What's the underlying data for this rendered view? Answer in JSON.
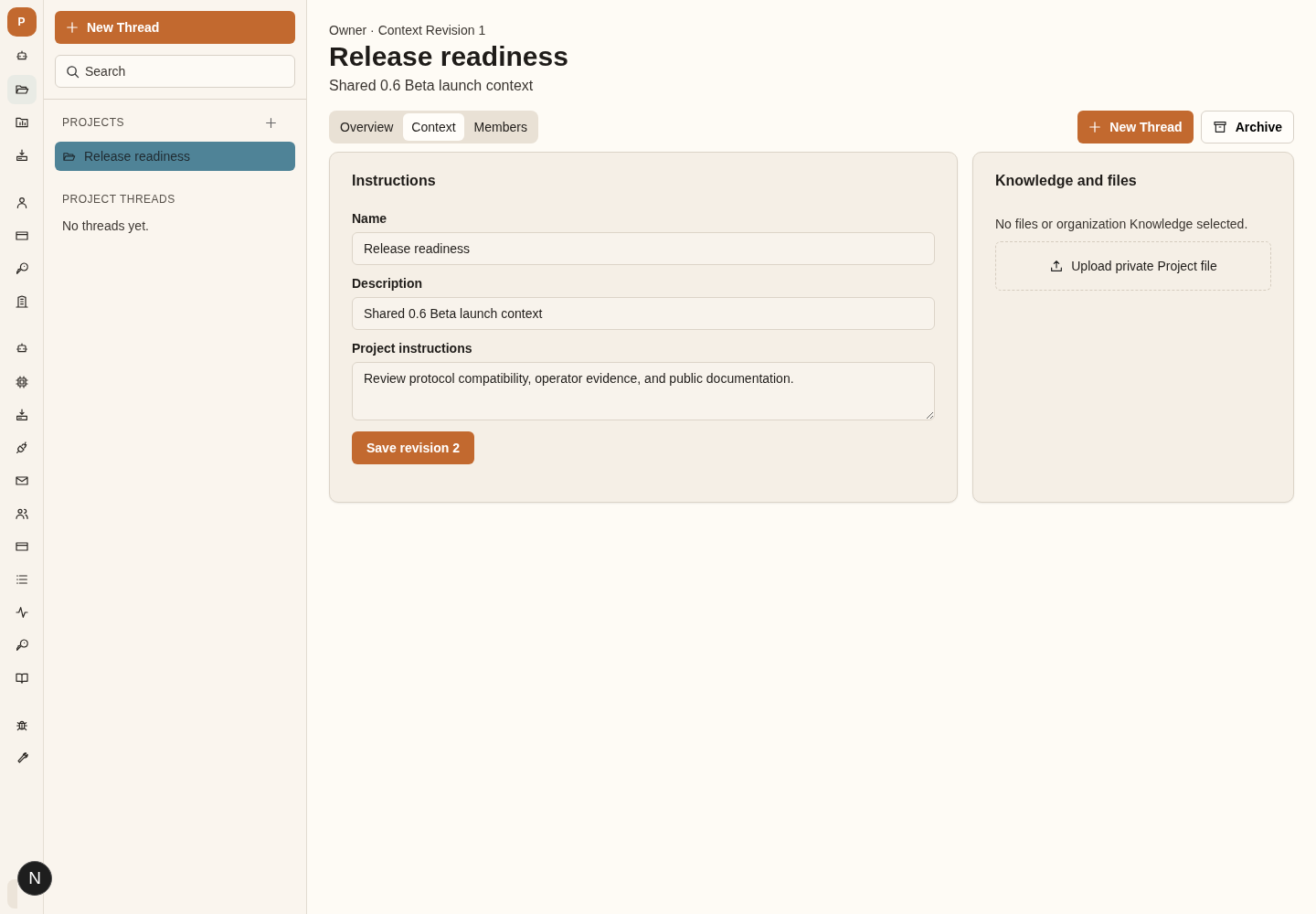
{
  "rail": {
    "avatar": "P",
    "groups": [
      [
        {
          "selected": false
        },
        {
          "selected": true
        },
        {
          "selected": false
        },
        {
          "selected": false
        }
      ],
      [
        {
          "selected": false
        },
        {
          "selected": false
        },
        {
          "selected": false
        },
        {
          "selected": false
        }
      ],
      [
        {
          "selected": false
        },
        {
          "selected": false
        },
        {
          "selected": false
        },
        {
          "selected": false
        },
        {
          "selected": false
        },
        {
          "selected": false
        },
        {
          "selected": false
        },
        {
          "selected": false
        },
        {
          "selected": false
        },
        {
          "selected": false
        },
        {
          "selected": false
        }
      ],
      [
        {
          "selected": false
        },
        {
          "selected": false
        }
      ]
    ],
    "user_badge": "N"
  },
  "sidebar": {
    "new_thread": "New Thread",
    "search": {
      "placeholder": "Search"
    },
    "projects_heading": "PROJECTS",
    "projects": [
      {
        "name": "Release readiness",
        "selected": true
      }
    ],
    "threads_heading": "PROJECT THREADS",
    "threads_empty": "No threads yet."
  },
  "header": {
    "breadcrumb": "Owner · Context Revision 1",
    "title": "Release readiness",
    "subtitle": "Shared 0.6 Beta launch context"
  },
  "tabs": [
    {
      "label": "Overview",
      "selected": false
    },
    {
      "label": "Context",
      "selected": true
    },
    {
      "label": "Members",
      "selected": false
    }
  ],
  "actions": {
    "new_thread": "New Thread",
    "archive": "Archive"
  },
  "instructions": {
    "title": "Instructions",
    "fields": [
      {
        "label": "Name",
        "value": "Release readiness",
        "kind": "input"
      },
      {
        "label": "Description",
        "value": "Shared 0.6 Beta launch context",
        "kind": "input"
      },
      {
        "label": "Project instructions",
        "value": "Review protocol compatibility, operator evidence, and public documentation.",
        "kind": "textarea"
      }
    ],
    "save": "Save revision 2"
  },
  "knowledge": {
    "title": "Knowledge and files",
    "empty": "No files or organization Knowledge selected.",
    "upload": "Upload private Project file"
  }
}
